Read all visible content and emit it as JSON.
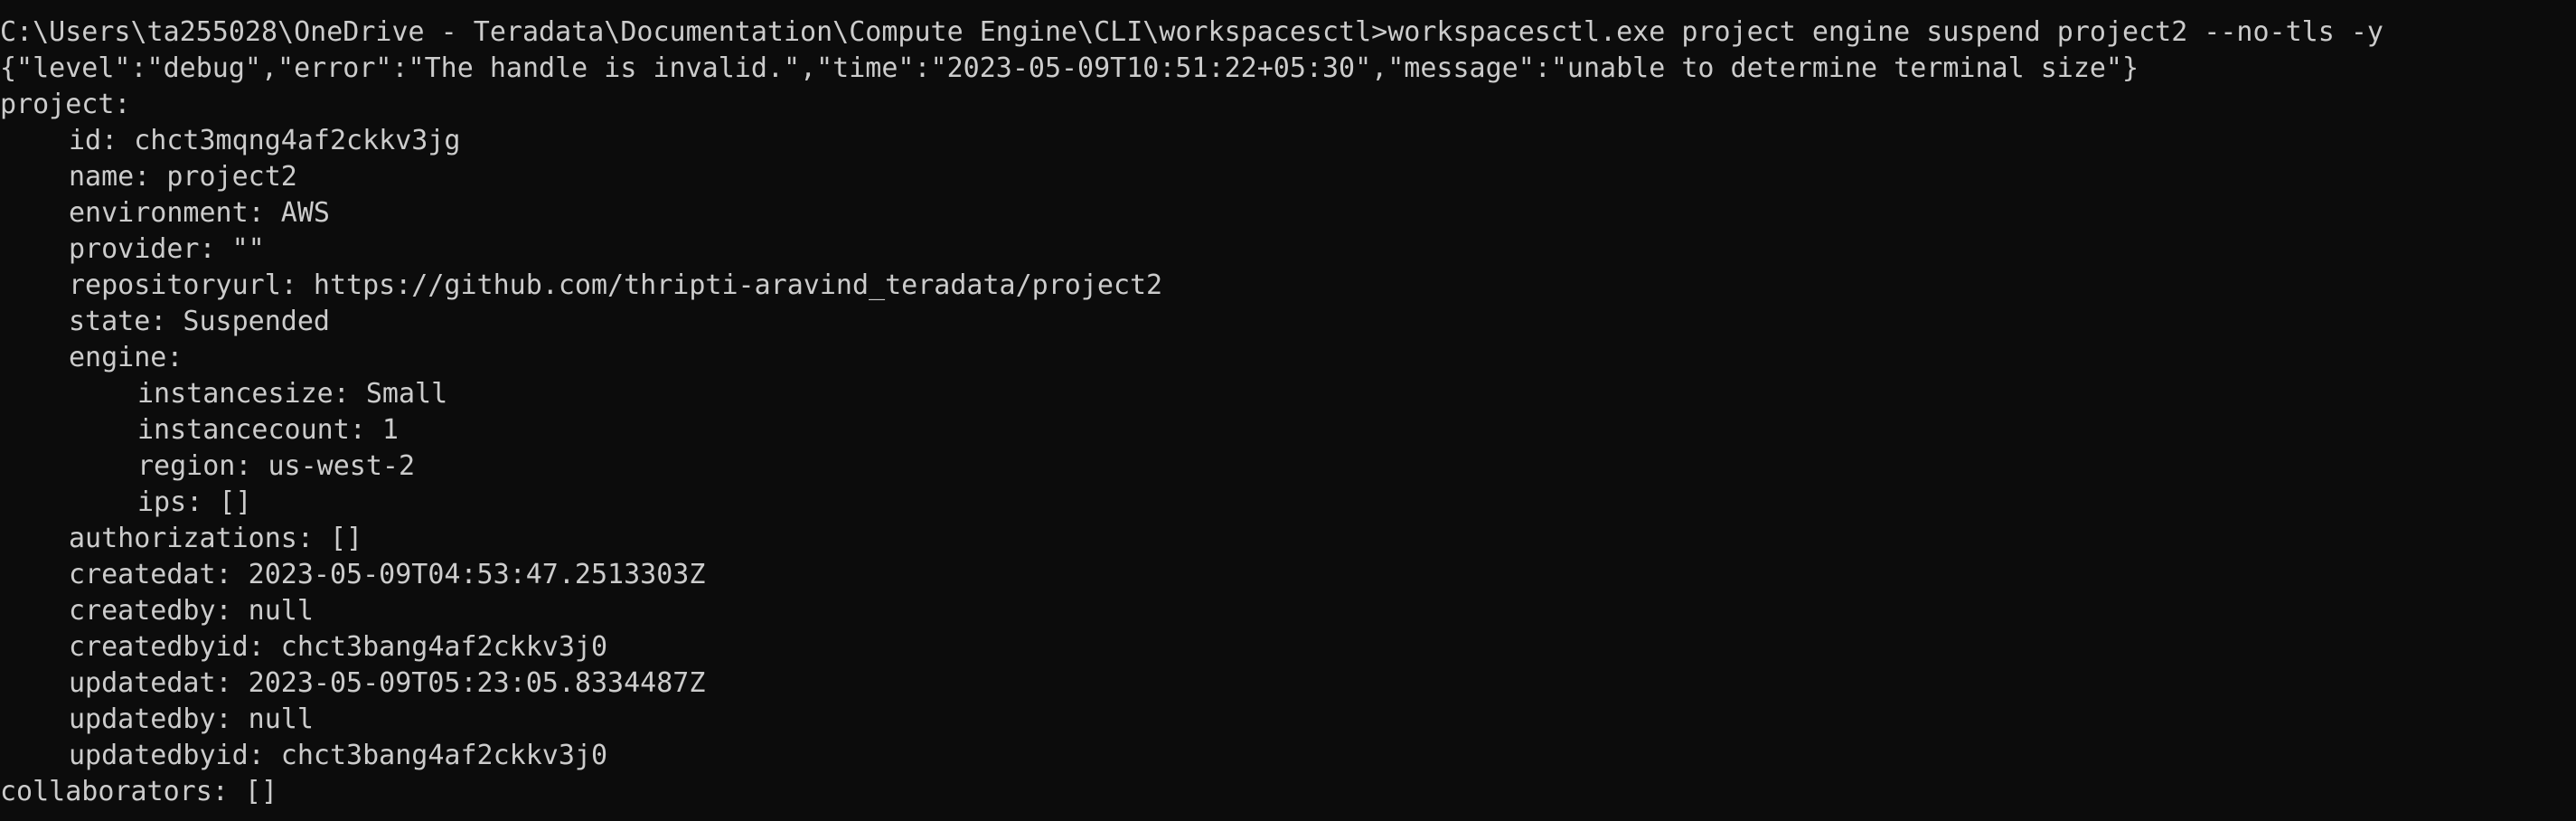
{
  "terminal": {
    "prompt": "C:\\Users\\ta255028\\OneDrive - Teradata\\Documentation\\Compute Engine\\CLI\\workspacesctl>",
    "command": "workspacesctl.exe project engine suspend project2 --no-tls -y",
    "log_line": "{\"level\":\"debug\",\"error\":\"The handle is invalid.\",\"time\":\"2023-05-09T10:51:22+05:30\",\"message\":\"unable to determine terminal size\"}",
    "output": {
      "project_header": "project:",
      "id": "id: chct3mqng4af2ckkv3jg",
      "name": "name: project2",
      "environment": "environment: AWS",
      "provider": "provider: \"\"",
      "repositoryurl": "repositoryurl: https://github.com/thripti-aravind_teradata/project2",
      "state": "state: Suspended",
      "engine_header": "engine:",
      "instancesize": "instancesize: Small",
      "instancecount": "instancecount: 1",
      "region": "region: us-west-2",
      "ips": "ips: []",
      "authorizations": "authorizations: []",
      "createdat": "createdat: 2023-05-09T04:53:47.2513303Z",
      "createdby": "createdby: null",
      "createdbyid": "createdbyid: chct3bang4af2ckkv3j0",
      "updatedat": "updatedat: 2023-05-09T05:23:05.8334487Z",
      "updatedby": "updatedby: null",
      "updatedbyid": "updatedbyid: chct3bang4af2ckkv3j0",
      "collaborators": "collaborators: []"
    },
    "colors": {
      "background": "#0c0c0c",
      "foreground": "#cccccc"
    }
  }
}
